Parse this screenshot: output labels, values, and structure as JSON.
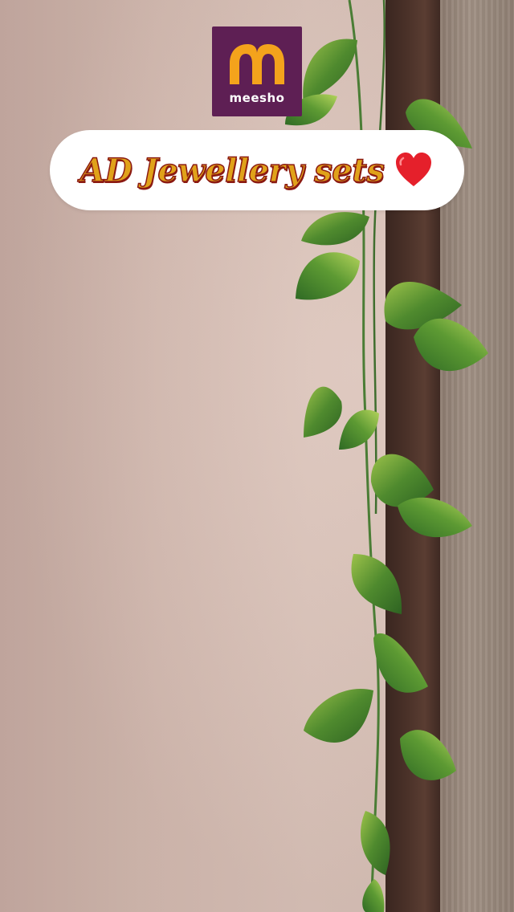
{
  "brand": {
    "name": "meesho",
    "logo_color": "#5e1f54",
    "logo_accent": "#f4a31c"
  },
  "banner": {
    "title": "AD Jewellery sets",
    "icon": "heart-icon",
    "text_color": "#e0a21a",
    "outline_color": "#8b1a12",
    "heart_color": "#e5202b"
  }
}
